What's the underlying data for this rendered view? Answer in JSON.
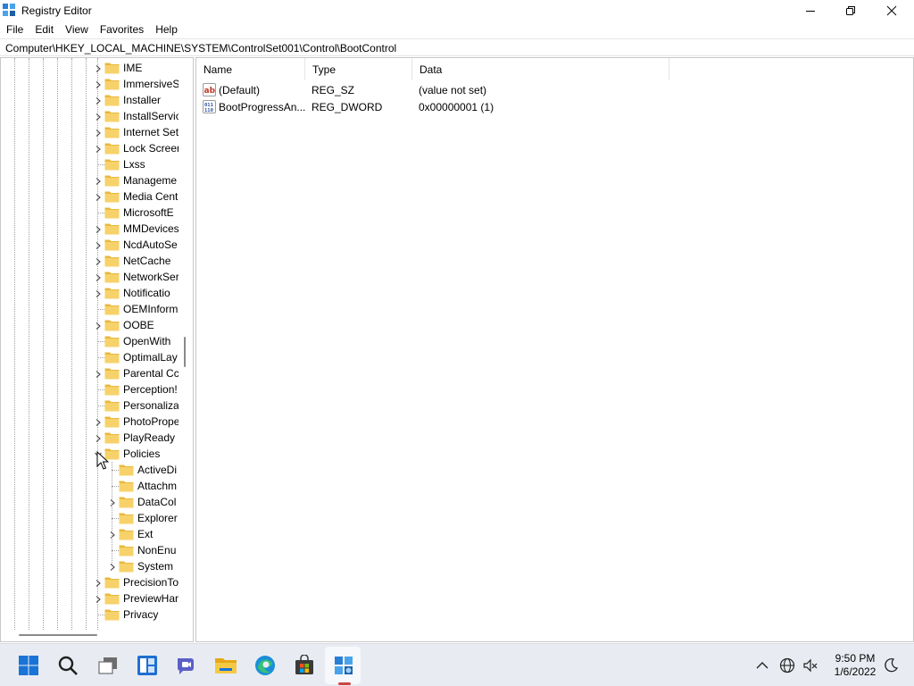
{
  "window": {
    "title": "Registry Editor"
  },
  "menu": [
    "File",
    "Edit",
    "View",
    "Favorites",
    "Help"
  ],
  "address": "Computer\\HKEY_LOCAL_MACHINE\\SYSTEM\\ControlSet001\\Control\\BootControl",
  "tree": [
    {
      "label": "IME",
      "expandable": true,
      "level": 1
    },
    {
      "label": "ImmersiveS",
      "expandable": true,
      "level": 1
    },
    {
      "label": "Installer",
      "expandable": true,
      "level": 1
    },
    {
      "label": "InstallServic",
      "expandable": true,
      "level": 1
    },
    {
      "label": "Internet Set",
      "expandable": true,
      "level": 1
    },
    {
      "label": "Lock Screer",
      "expandable": true,
      "level": 1
    },
    {
      "label": "Lxss",
      "expandable": false,
      "level": 1
    },
    {
      "label": "Manageme",
      "expandable": true,
      "level": 1
    },
    {
      "label": "Media Cent",
      "expandable": true,
      "level": 1
    },
    {
      "label": "MicrosoftE",
      "expandable": false,
      "level": 1
    },
    {
      "label": "MMDevices",
      "expandable": true,
      "level": 1
    },
    {
      "label": "NcdAutoSe",
      "expandable": true,
      "level": 1
    },
    {
      "label": "NetCache",
      "expandable": true,
      "level": 1
    },
    {
      "label": "NetworkSer",
      "expandable": true,
      "level": 1
    },
    {
      "label": "Notificatio",
      "expandable": true,
      "level": 1
    },
    {
      "label": "OEMInform",
      "expandable": false,
      "level": 1
    },
    {
      "label": "OOBE",
      "expandable": true,
      "level": 1
    },
    {
      "label": "OpenWith",
      "expandable": false,
      "level": 1
    },
    {
      "label": "OptimalLay",
      "expandable": false,
      "level": 1
    },
    {
      "label": "Parental Cc",
      "expandable": true,
      "level": 1
    },
    {
      "label": "Perception!",
      "expandable": false,
      "level": 1
    },
    {
      "label": "Personaliza",
      "expandable": false,
      "level": 1
    },
    {
      "label": "PhotoPrope",
      "expandable": true,
      "level": 1
    },
    {
      "label": "PlayReady",
      "expandable": true,
      "level": 1
    },
    {
      "label": "Policies",
      "expandable": true,
      "expanded": true,
      "level": 1
    },
    {
      "label": "ActiveDi",
      "expandable": false,
      "level": 2
    },
    {
      "label": "Attachm",
      "expandable": false,
      "level": 2
    },
    {
      "label": "DataCol",
      "expandable": true,
      "level": 2
    },
    {
      "label": "Explorer",
      "expandable": false,
      "level": 2
    },
    {
      "label": "Ext",
      "expandable": true,
      "level": 2
    },
    {
      "label": "NonEnu",
      "expandable": false,
      "level": 2
    },
    {
      "label": "System",
      "expandable": true,
      "level": 2
    },
    {
      "label": "PrecisionTo",
      "expandable": true,
      "level": 1
    },
    {
      "label": "PreviewHar",
      "expandable": true,
      "level": 1
    },
    {
      "label": "Privacy",
      "expandable": false,
      "level": 1
    }
  ],
  "columns": [
    "Name",
    "Type",
    "Data"
  ],
  "values": [
    {
      "name": "(Default)",
      "type": "REG_SZ",
      "data": "(value not set)",
      "icon": "string-value-icon"
    },
    {
      "name": "BootProgressAn...",
      "type": "REG_DWORD",
      "data": "0x00000001 (1)",
      "icon": "binary-value-icon"
    }
  ],
  "taskbar": {
    "apps": [
      "start-icon",
      "search-icon",
      "task-view-icon",
      "widgets-icon",
      "chat-icon",
      "file-explorer-icon",
      "edge-icon",
      "store-icon",
      "registry-editor-icon"
    ],
    "time": "9:50 PM",
    "date": "1/6/2022"
  },
  "colors": {
    "folder": "#f2c94c",
    "accent": "#0067c0",
    "taskbar": "#e8ecf2"
  }
}
